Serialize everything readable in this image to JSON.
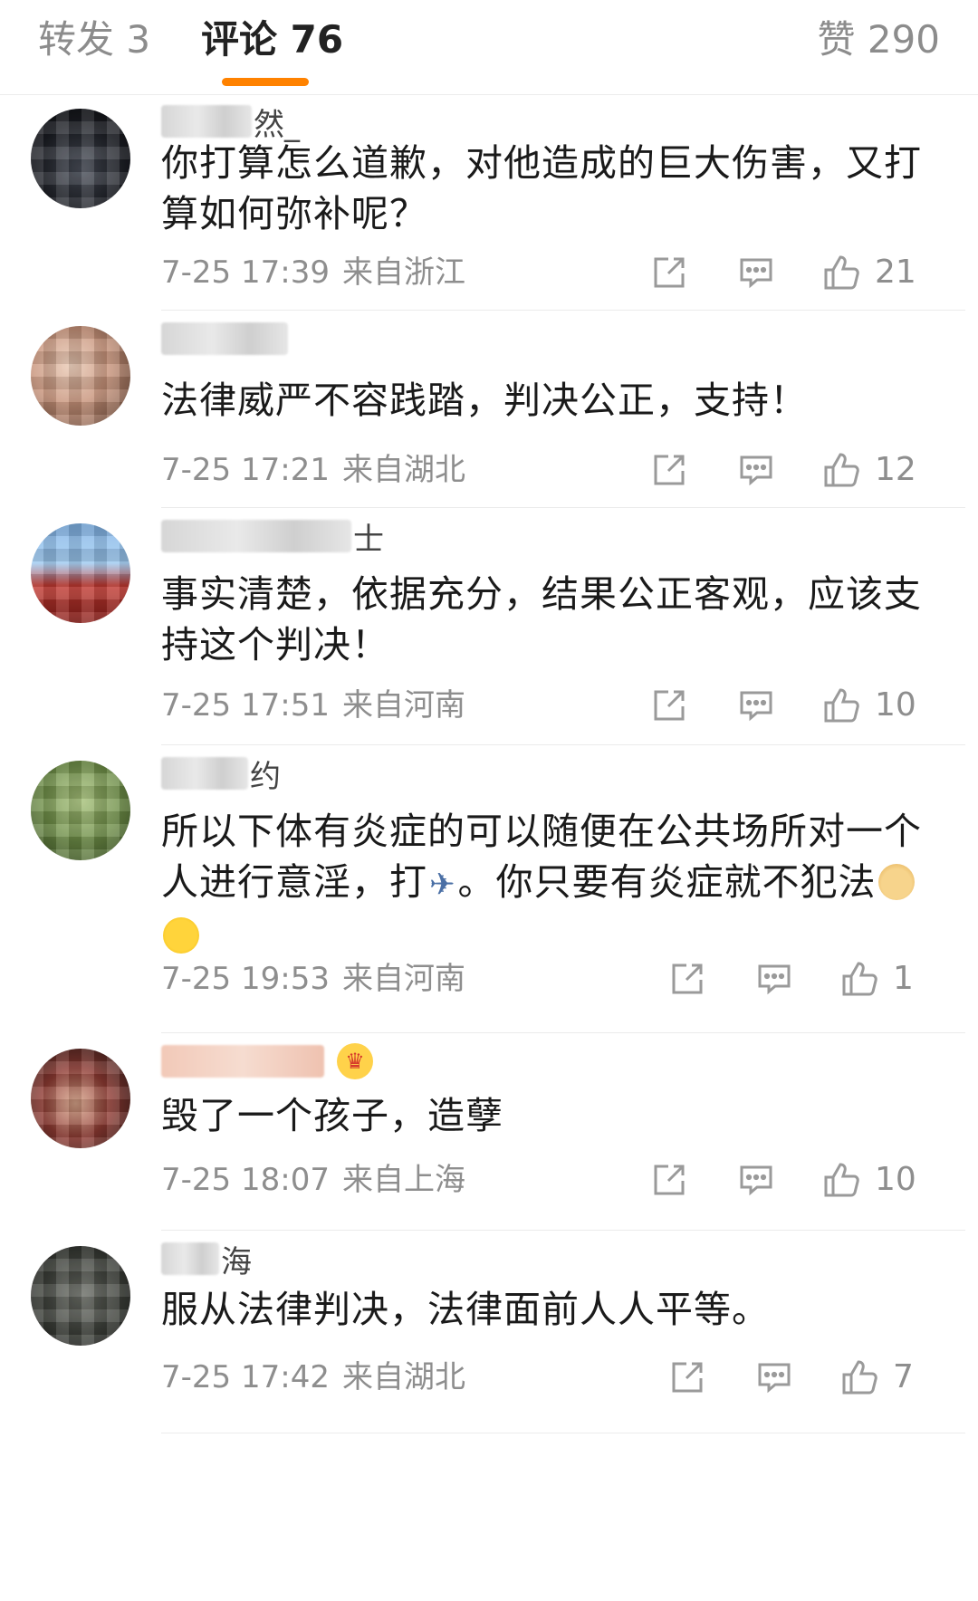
{
  "tabs": {
    "repost": "转发 3",
    "comments": "评论 76",
    "likes": "赞 290"
  },
  "colors": {
    "accent": "#ff8200",
    "text_primary": "#1a1a1a",
    "text_secondary": "#8e8e8e"
  },
  "comments": [
    {
      "name_suffix": "然_",
      "text": "你打算怎么道歉，对他造成的巨大伤害，又打算如何弥补呢？",
      "time": "7-25 17:39",
      "location": "来自浙江",
      "likes": "21"
    },
    {
      "name_suffix": "",
      "text": "法律威严不容践踏，判决公正，支持！",
      "time": "7-25 17:21",
      "location": "来自湖北",
      "likes": "12"
    },
    {
      "name_suffix": "士",
      "text": "事实清楚，依据充分，结果公正客观，应该支持这个判决！",
      "time": "7-25 17:51",
      "location": "来自河南",
      "likes": "10"
    },
    {
      "name_suffix": "约",
      "text_part1": "所以下体有炎症的可以随便在公共场所对一个人进行意淫，打",
      "text_part2": "。你只要有炎症就不犯法",
      "time": "7-25 19:53",
      "location": "来自河南",
      "likes": "1"
    },
    {
      "name_suffix": "",
      "text": "毁了一个孩子，造孽",
      "time": "7-25 18:07",
      "location": "来自上海",
      "likes": "10"
    },
    {
      "name_suffix": "海",
      "text": "服从法律判决，法律面前人人平等。",
      "time": "7-25 17:42",
      "location": "来自湖北",
      "likes": "7"
    }
  ],
  "icons": {
    "share": "share-icon",
    "reply": "comment-icon",
    "like": "thumbs-up-icon",
    "emoji_doge": "doge-emoji-icon",
    "emoji_laugh": "laugh-cry-emoji-icon",
    "emoji_plane": "airplane-emoji-icon",
    "badge": "crown-badge-icon"
  }
}
